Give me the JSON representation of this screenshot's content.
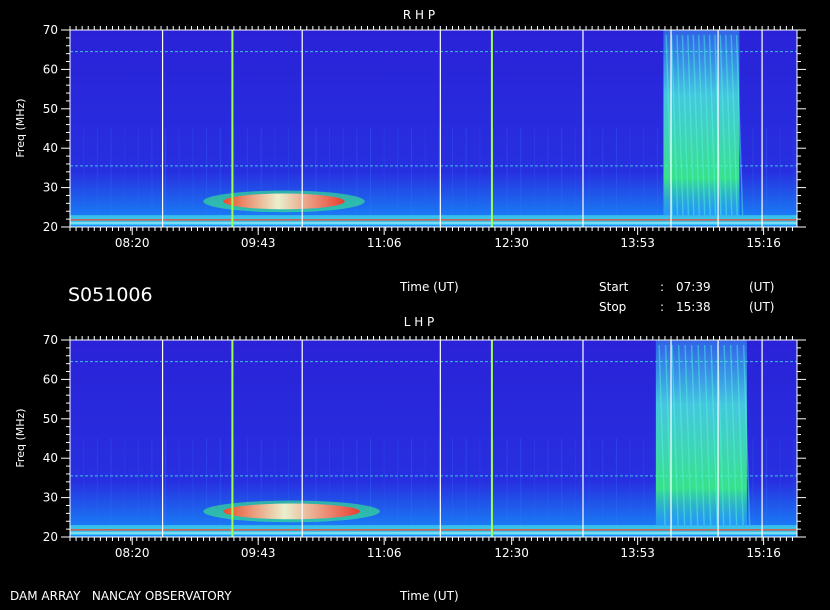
{
  "colors": {
    "background": "#000000",
    "text": "#ffffff",
    "spectrum_base": "#2a22d8",
    "spectrum_band": "#1e8cff",
    "emission_green": "#3cff7a",
    "emission_cyan": "#4ffbe0",
    "emission_hot": "#ff4020",
    "vertical_marker": "#9cff50",
    "reference_line": "#ffffff"
  },
  "header": {
    "session_id": "S051006",
    "time_label": "Time (UT)",
    "start_label": "Start",
    "start_value": "07:39",
    "stop_label": "Stop",
    "stop_value": "15:38",
    "separator": ":",
    "unit": "(UT)"
  },
  "footer": {
    "observatory": "DAM ARRAY   NANCAY OBSERVATORY",
    "time_label": "Time (UT)"
  },
  "chart_data": [
    {
      "type": "heatmap",
      "title": "R H P",
      "ylabel": "Freq (MHz)",
      "xlabel": "",
      "ylim": [
        20,
        70
      ],
      "yticks": [
        20,
        30,
        40,
        50,
        60,
        70
      ],
      "xlim_minutes": [
        459,
        938
      ],
      "xtick_labels": [
        "08:20",
        "09:43",
        "11:06",
        "12:30",
        "13:53",
        "15:16"
      ],
      "xtick_minutes": [
        500,
        583,
        666,
        750,
        833,
        916
      ],
      "white_markers_min": [
        520,
        612,
        703,
        797,
        855,
        886,
        915
      ],
      "colored_markers_min": [
        566,
        737
      ],
      "emission_features": [
        {
          "kind": "hot_band",
          "t0": 560,
          "t1": 640,
          "f0": 24.5,
          "f1": 28.5
        },
        {
          "kind": "band",
          "t0": 459,
          "t1": 938,
          "f0": 20.5,
          "f1": 23
        },
        {
          "kind": "burst",
          "t0": 850,
          "t1": 900,
          "f0": 23,
          "f1": 70
        }
      ]
    },
    {
      "type": "heatmap",
      "title": "L H P",
      "ylabel": "Freq (MHz)",
      "xlabel": "",
      "ylim": [
        20,
        70
      ],
      "yticks": [
        20,
        30,
        40,
        50,
        60,
        70
      ],
      "xlim_minutes": [
        459,
        938
      ],
      "xtick_labels": [
        "08:20",
        "09:43",
        "11:06",
        "12:30",
        "13:53",
        "15:16"
      ],
      "xtick_minutes": [
        500,
        583,
        666,
        750,
        833,
        916
      ],
      "white_markers_min": [
        520,
        612,
        703,
        797,
        855,
        886,
        915
      ],
      "colored_markers_min": [
        566,
        737
      ],
      "emission_features": [
        {
          "kind": "hot_band",
          "t0": 560,
          "t1": 650,
          "f0": 24.5,
          "f1": 28.5
        },
        {
          "kind": "band",
          "t0": 459,
          "t1": 938,
          "f0": 20.5,
          "f1": 23
        },
        {
          "kind": "burst",
          "t0": 845,
          "t1": 905,
          "f0": 23,
          "f1": 70
        }
      ]
    }
  ]
}
